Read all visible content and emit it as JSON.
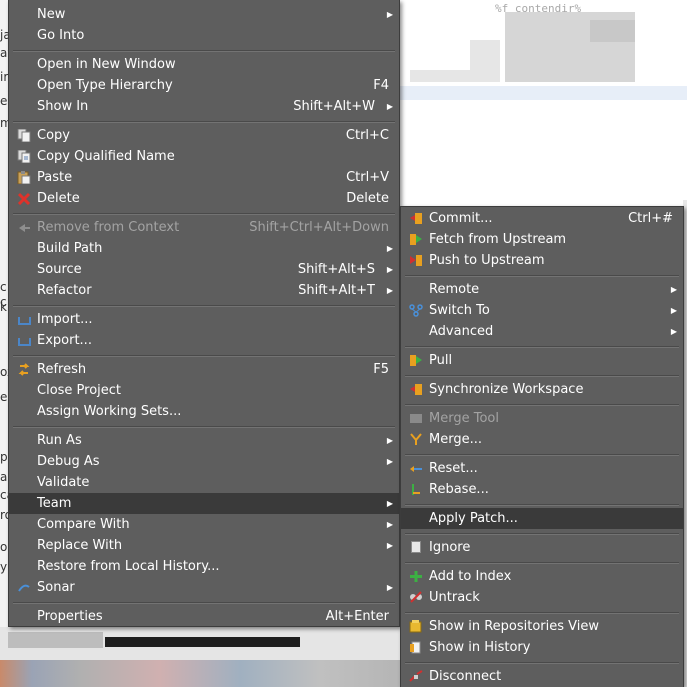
{
  "background": {
    "blurred_code_text": "%f contendir%",
    "left_strip_letters": [
      "ja",
      "av",
      "ire",
      "ed",
      "m",
      "c",
      "c",
      "k",
      "ox",
      "e",
      "p",
      "au",
      "ca",
      "ro",
      "o",
      "y"
    ]
  },
  "main_menu": {
    "items": [
      {
        "label": "New",
        "shortcut": "",
        "submenu": true,
        "icon": ""
      },
      {
        "label": "Go Into",
        "shortcut": "",
        "submenu": false,
        "icon": ""
      },
      {
        "label": "Open in New Window",
        "shortcut": "",
        "submenu": false,
        "icon": ""
      },
      {
        "label": "Open Type Hierarchy",
        "shortcut": "F4",
        "submenu": false,
        "icon": ""
      },
      {
        "label": "Show In",
        "shortcut": "Shift+Alt+W",
        "submenu": true,
        "icon": ""
      },
      {
        "label": "Copy",
        "shortcut": "Ctrl+C",
        "submenu": false,
        "icon": "copy-icon"
      },
      {
        "label": "Copy Qualified Name",
        "shortcut": "",
        "submenu": false,
        "icon": "copy-qualified-name-icon"
      },
      {
        "label": "Paste",
        "shortcut": "Ctrl+V",
        "submenu": false,
        "icon": "paste-icon"
      },
      {
        "label": "Delete",
        "shortcut": "Delete",
        "submenu": false,
        "icon": "delete-icon"
      },
      {
        "label": "Remove from Context",
        "shortcut": "Shift+Ctrl+Alt+Down",
        "submenu": false,
        "icon": "remove-context-icon",
        "disabled": true
      },
      {
        "label": "Build Path",
        "shortcut": "",
        "submenu": true,
        "icon": ""
      },
      {
        "label": "Source",
        "shortcut": "Shift+Alt+S",
        "submenu": true,
        "icon": ""
      },
      {
        "label": "Refactor",
        "shortcut": "Shift+Alt+T",
        "submenu": true,
        "icon": ""
      },
      {
        "label": "Import...",
        "shortcut": "",
        "submenu": false,
        "icon": "import-icon"
      },
      {
        "label": "Export...",
        "shortcut": "",
        "submenu": false,
        "icon": "export-icon"
      },
      {
        "label": "Refresh",
        "shortcut": "F5",
        "submenu": false,
        "icon": "refresh-icon"
      },
      {
        "label": "Close Project",
        "shortcut": "",
        "submenu": false,
        "icon": ""
      },
      {
        "label": "Assign Working Sets...",
        "shortcut": "",
        "submenu": false,
        "icon": ""
      },
      {
        "label": "Run As",
        "shortcut": "",
        "submenu": true,
        "icon": ""
      },
      {
        "label": "Debug As",
        "shortcut": "",
        "submenu": true,
        "icon": ""
      },
      {
        "label": "Validate",
        "shortcut": "",
        "submenu": false,
        "icon": ""
      },
      {
        "label": "Team",
        "shortcut": "",
        "submenu": true,
        "icon": "",
        "highlighted": true
      },
      {
        "label": "Compare With",
        "shortcut": "",
        "submenu": true,
        "icon": ""
      },
      {
        "label": "Replace With",
        "shortcut": "",
        "submenu": true,
        "icon": ""
      },
      {
        "label": "Restore from Local History...",
        "shortcut": "",
        "submenu": false,
        "icon": ""
      },
      {
        "label": "Sonar",
        "shortcut": "",
        "submenu": true,
        "icon": "sonar-icon"
      },
      {
        "label": "Properties",
        "shortcut": "Alt+Enter",
        "submenu": false,
        "icon": ""
      }
    ]
  },
  "team_submenu": {
    "items": [
      {
        "label": "Commit...",
        "shortcut": "Ctrl+#",
        "submenu": false,
        "icon": "commit-icon"
      },
      {
        "label": "Fetch from Upstream",
        "shortcut": "",
        "submenu": false,
        "icon": "fetch-icon"
      },
      {
        "label": "Push to Upstream",
        "shortcut": "",
        "submenu": false,
        "icon": "push-icon"
      },
      {
        "label": "Remote",
        "shortcut": "",
        "submenu": true,
        "icon": ""
      },
      {
        "label": "Switch To",
        "shortcut": "",
        "submenu": true,
        "icon": "switch-to-icon"
      },
      {
        "label": "Advanced",
        "shortcut": "",
        "submenu": true,
        "icon": ""
      },
      {
        "label": "Pull",
        "shortcut": "",
        "submenu": false,
        "icon": "pull-icon"
      },
      {
        "label": "Synchronize Workspace",
        "shortcut": "",
        "submenu": false,
        "icon": "synchronize-icon"
      },
      {
        "label": "Merge Tool",
        "shortcut": "",
        "submenu": false,
        "icon": "merge-tool-icon",
        "disabled": true
      },
      {
        "label": "Merge...",
        "shortcut": "",
        "submenu": false,
        "icon": "merge-icon"
      },
      {
        "label": "Reset...",
        "shortcut": "",
        "submenu": false,
        "icon": "reset-icon"
      },
      {
        "label": "Rebase...",
        "shortcut": "",
        "submenu": false,
        "icon": "rebase-icon"
      },
      {
        "label": "Apply Patch...",
        "shortcut": "",
        "submenu": false,
        "icon": "",
        "highlighted": true
      },
      {
        "label": "Ignore",
        "shortcut": "",
        "submenu": false,
        "icon": "ignore-icon"
      },
      {
        "label": "Add to Index",
        "shortcut": "",
        "submenu": false,
        "icon": "add-to-index-icon"
      },
      {
        "label": "Untrack",
        "shortcut": "",
        "submenu": false,
        "icon": "untrack-icon"
      },
      {
        "label": "Show in Repositories View",
        "shortcut": "",
        "submenu": false,
        "icon": "repositories-view-icon"
      },
      {
        "label": "Show in History",
        "shortcut": "",
        "submenu": false,
        "icon": "history-icon"
      },
      {
        "label": "Disconnect",
        "shortcut": "",
        "submenu": false,
        "icon": "disconnect-icon"
      }
    ]
  },
  "colors": {
    "menu_bg": "#5e5e5e",
    "highlight_bg": "#3a3a3a",
    "text": "#ffffff",
    "disabled_text": "#a3a3a3"
  }
}
